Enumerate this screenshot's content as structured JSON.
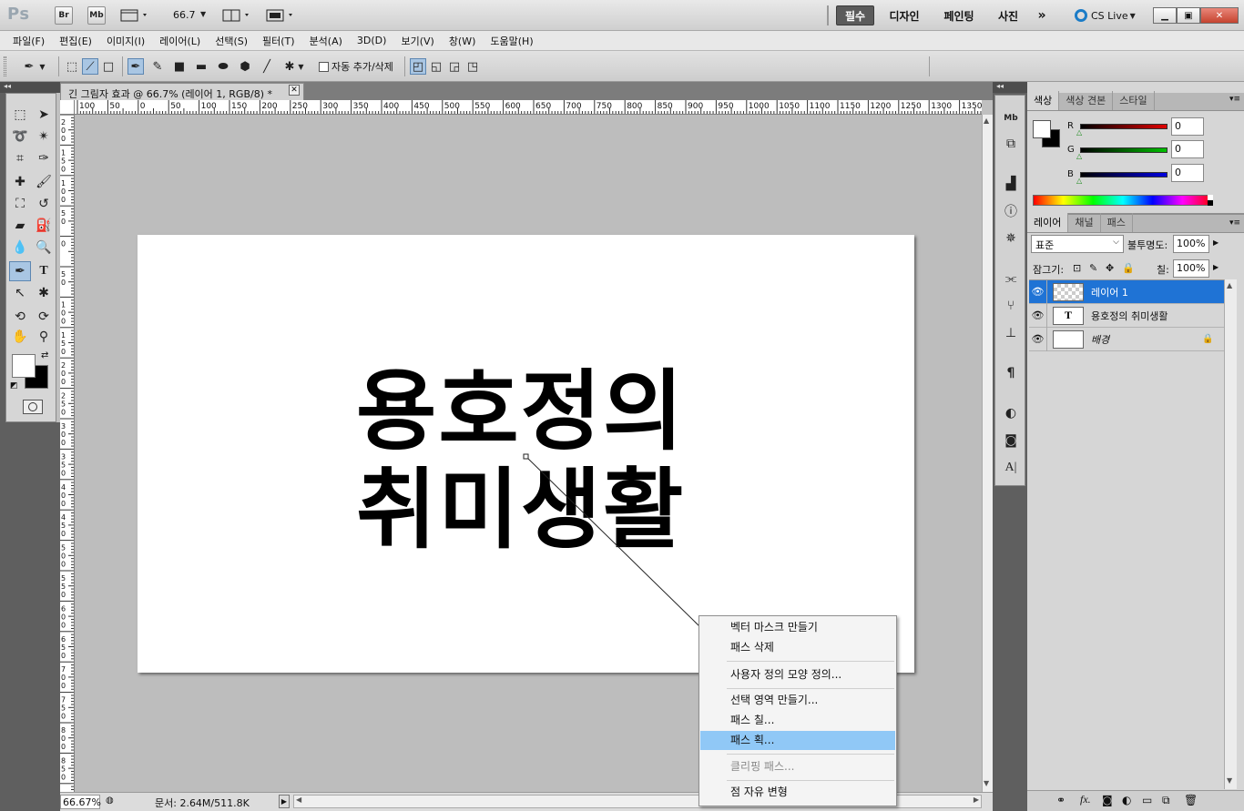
{
  "app": {
    "logo": "Ps",
    "bridge": "Br",
    "minibridge": "Mb",
    "zoom": "66.7",
    "workspaces": [
      "필수",
      "디자인",
      "페인팅",
      "사진"
    ],
    "active_workspace": "필수",
    "more": "»",
    "cslive": "CS Live"
  },
  "menu": [
    "파일(F)",
    "편집(E)",
    "이미지(I)",
    "레이어(L)",
    "선택(S)",
    "필터(T)",
    "분석(A)",
    "3D(D)",
    "보기(V)",
    "창(W)",
    "도움말(H)"
  ],
  "options": {
    "auto_add_delete": "자동 추가/삭제"
  },
  "document": {
    "tab_title": "긴 그림자 효과 @ 66.7% (레이어 1, RGB/8) *",
    "text_line1": "용호정의",
    "text_line2": "취미생활",
    "ruler_top_labels": [
      "100",
      "50",
      "0",
      "50",
      "100",
      "150",
      "200",
      "250",
      "300",
      "350",
      "400",
      "450",
      "500",
      "550",
      "600",
      "650",
      "700",
      "750",
      "800",
      "850",
      "900",
      "950",
      "1000",
      "1050",
      "1100",
      "1150",
      "1200",
      "1250",
      "1300",
      "1350"
    ],
    "ruler_left_labels": [
      "2 0 0",
      "1 5 0",
      "1 0 0",
      "5 0",
      "0",
      "5 0",
      "1 0 0",
      "1 5 0",
      "2 0 0",
      "2 5 0",
      "3 0 0",
      "3 5 0",
      "4 0 0",
      "4 5 0",
      "5 0 0",
      "5 5 0",
      "6 0 0",
      "6 5 0",
      "7 0 0",
      "7 5 0",
      "8 0 0",
      "8 5 0"
    ]
  },
  "status": {
    "zoom": "66.67%",
    "doc_info": "문서: 2.64M/511.8K"
  },
  "color_panel": {
    "tabs": [
      "색상",
      "색상 견본",
      "스타일"
    ],
    "channels": [
      {
        "label": "R",
        "value": "0",
        "color": "#e00000"
      },
      {
        "label": "G",
        "value": "0",
        "color": "#00c000"
      },
      {
        "label": "B",
        "value": "0",
        "color": "#0000e0"
      }
    ]
  },
  "layers_panel": {
    "tabs": [
      "레이어",
      "채널",
      "패스"
    ],
    "blend_mode": "표준",
    "opacity_label": "불투명도:",
    "opacity": "100%",
    "lock_label": "잠그기:",
    "fill_label": "칠:",
    "fill": "100%",
    "layers": [
      {
        "name": "레이어 1",
        "thumb": "",
        "selected": true
      },
      {
        "name": "용호정의 취미생활",
        "thumb": "T",
        "selected": false
      },
      {
        "name": "배경",
        "thumb": "",
        "selected": false
      }
    ]
  },
  "context_menu": {
    "items": [
      {
        "label": "벡터 마스크 만들기",
        "state": "normal"
      },
      {
        "label": "패스 삭제",
        "state": "normal"
      },
      {
        "label": "사용자 정의 모양 정의...",
        "state": "normal"
      },
      {
        "label": "선택 영역 만들기...",
        "state": "normal"
      },
      {
        "label": "패스 칠...",
        "state": "normal"
      },
      {
        "label": "패스 획...",
        "state": "highlighted"
      },
      {
        "label": "클리핑 패스...",
        "state": "disabled"
      },
      {
        "label": "점 자유 변형",
        "state": "normal"
      }
    ]
  },
  "colors": {
    "accent": "#1f73d5",
    "menu_highlight": "#90c8f6"
  }
}
